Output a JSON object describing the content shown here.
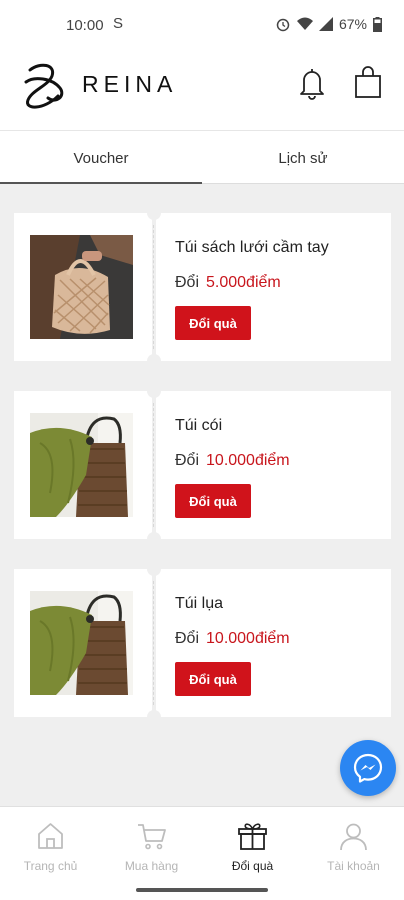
{
  "status_bar": {
    "time": "10:00",
    "battery": "67%"
  },
  "header": {
    "brand": "REINA"
  },
  "tabs": [
    {
      "label": "Voucher"
    },
    {
      "label": "Lịch sử"
    }
  ],
  "vouchers": [
    {
      "title": "Túi sách lưới cầm tay",
      "price_prefix": "Đổi",
      "price": "5.000điểm",
      "button": "Đổi quà"
    },
    {
      "title": "Túi cói",
      "price_prefix": "Đổi",
      "price": "10.000điểm",
      "button": "Đổi quà"
    },
    {
      "title": "Túi lụa",
      "price_prefix": "Đổi",
      "price": "10.000điểm",
      "button": "Đổi quà"
    }
  ],
  "bottom_nav": [
    {
      "label": "Trang chủ",
      "icon": "home-icon"
    },
    {
      "label": "Mua hàng",
      "icon": "cart-icon"
    },
    {
      "label": "Đổi quà",
      "icon": "gift-icon",
      "active": true
    },
    {
      "label": "Tài khoản",
      "icon": "user-icon"
    }
  ],
  "colors": {
    "accent": "#d0131b",
    "price": "#c8161d",
    "messenger": "#2b86f2",
    "background": "#efefef"
  }
}
